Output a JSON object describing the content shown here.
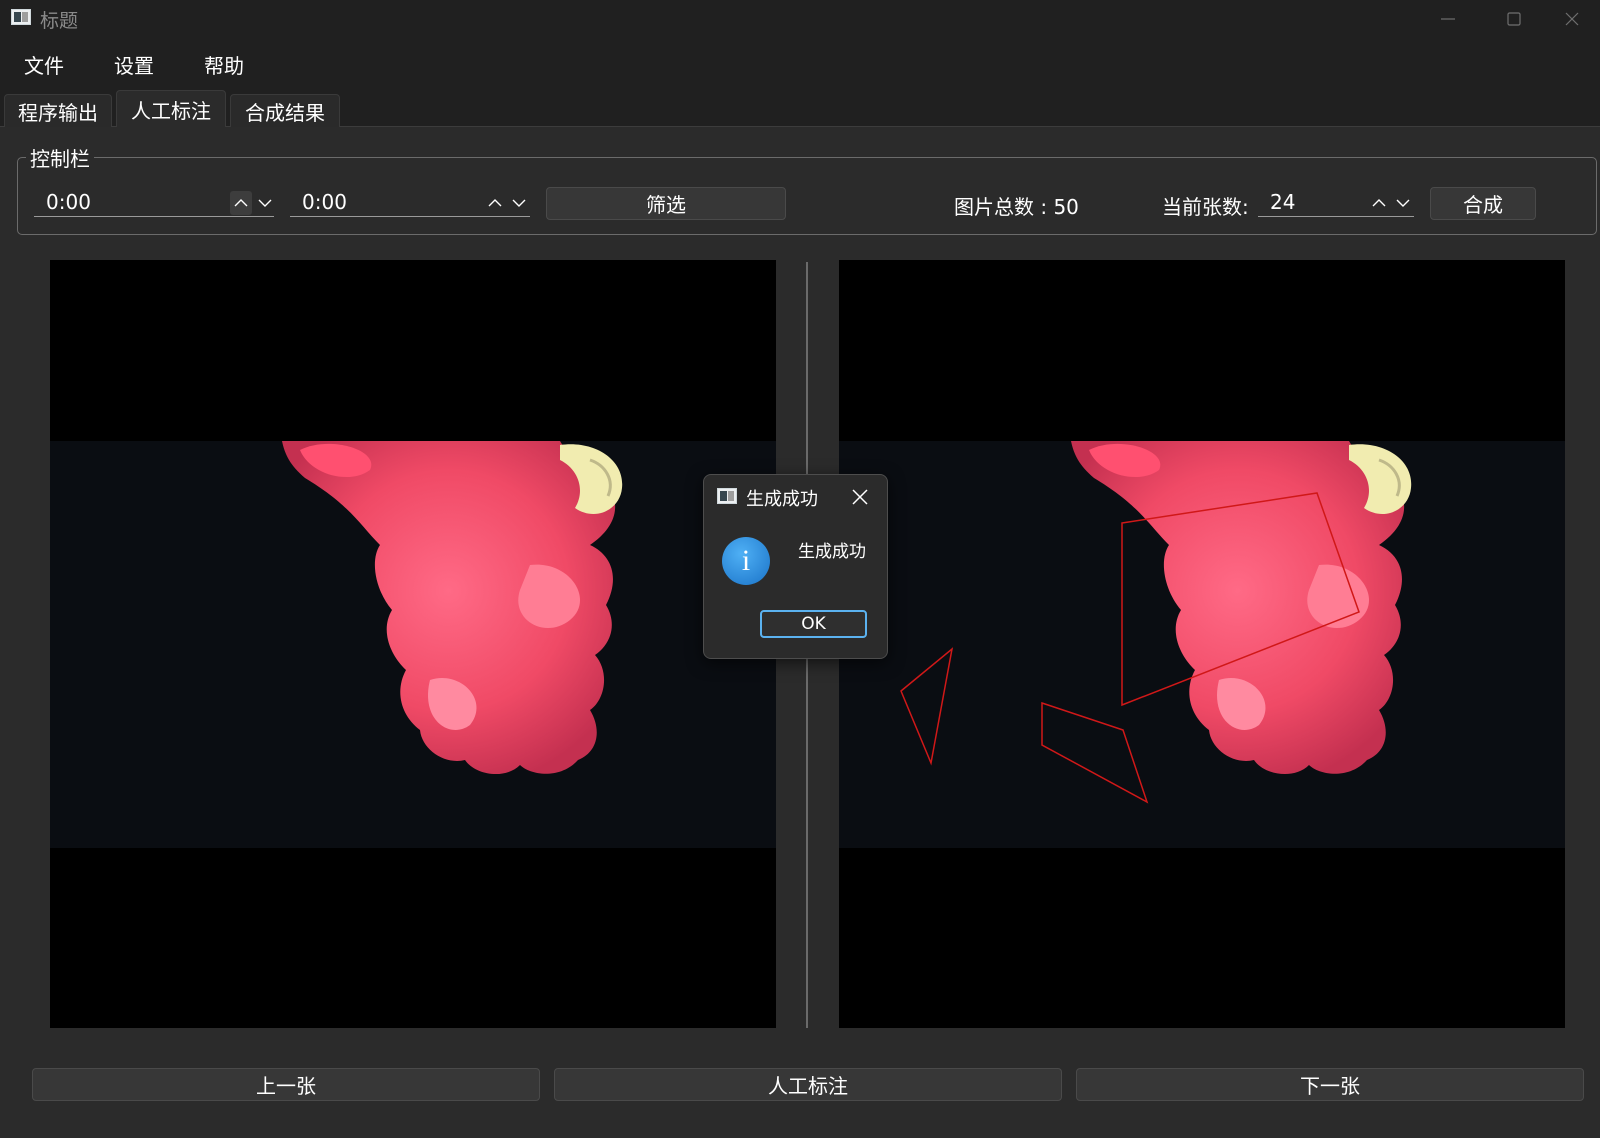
{
  "window": {
    "title": "标题",
    "controls": [
      "minimize-icon",
      "maximize-icon",
      "close-icon"
    ]
  },
  "menu": {
    "items": [
      {
        "label": "文件"
      },
      {
        "label": "设置"
      },
      {
        "label": "帮助"
      }
    ]
  },
  "tabs": [
    {
      "label": "程序输出",
      "active": false
    },
    {
      "label": "人工标注",
      "active": true
    },
    {
      "label": "合成结果",
      "active": false
    }
  ],
  "controls": {
    "group_title": "控制栏",
    "start_time": "0:00",
    "end_time": "0:00",
    "filter_label": "筛选",
    "total_label": "图片总数 : 50",
    "current_label": "当前张数:",
    "current_value": "24",
    "compose_label": "合成"
  },
  "dialog": {
    "title": "生成成功",
    "message": "生成成功",
    "ok_label": "OK",
    "icon": "info-icon"
  },
  "bottom": {
    "prev_label": "上一张",
    "annotate_label": "人工标注",
    "next_label": "下一张"
  },
  "colors": {
    "background": "#202020",
    "panel": "#2b2b2b",
    "button": "#373737",
    "accent": "#5bb2f0",
    "annotation": "#d01818",
    "ink": "#f0506a"
  }
}
